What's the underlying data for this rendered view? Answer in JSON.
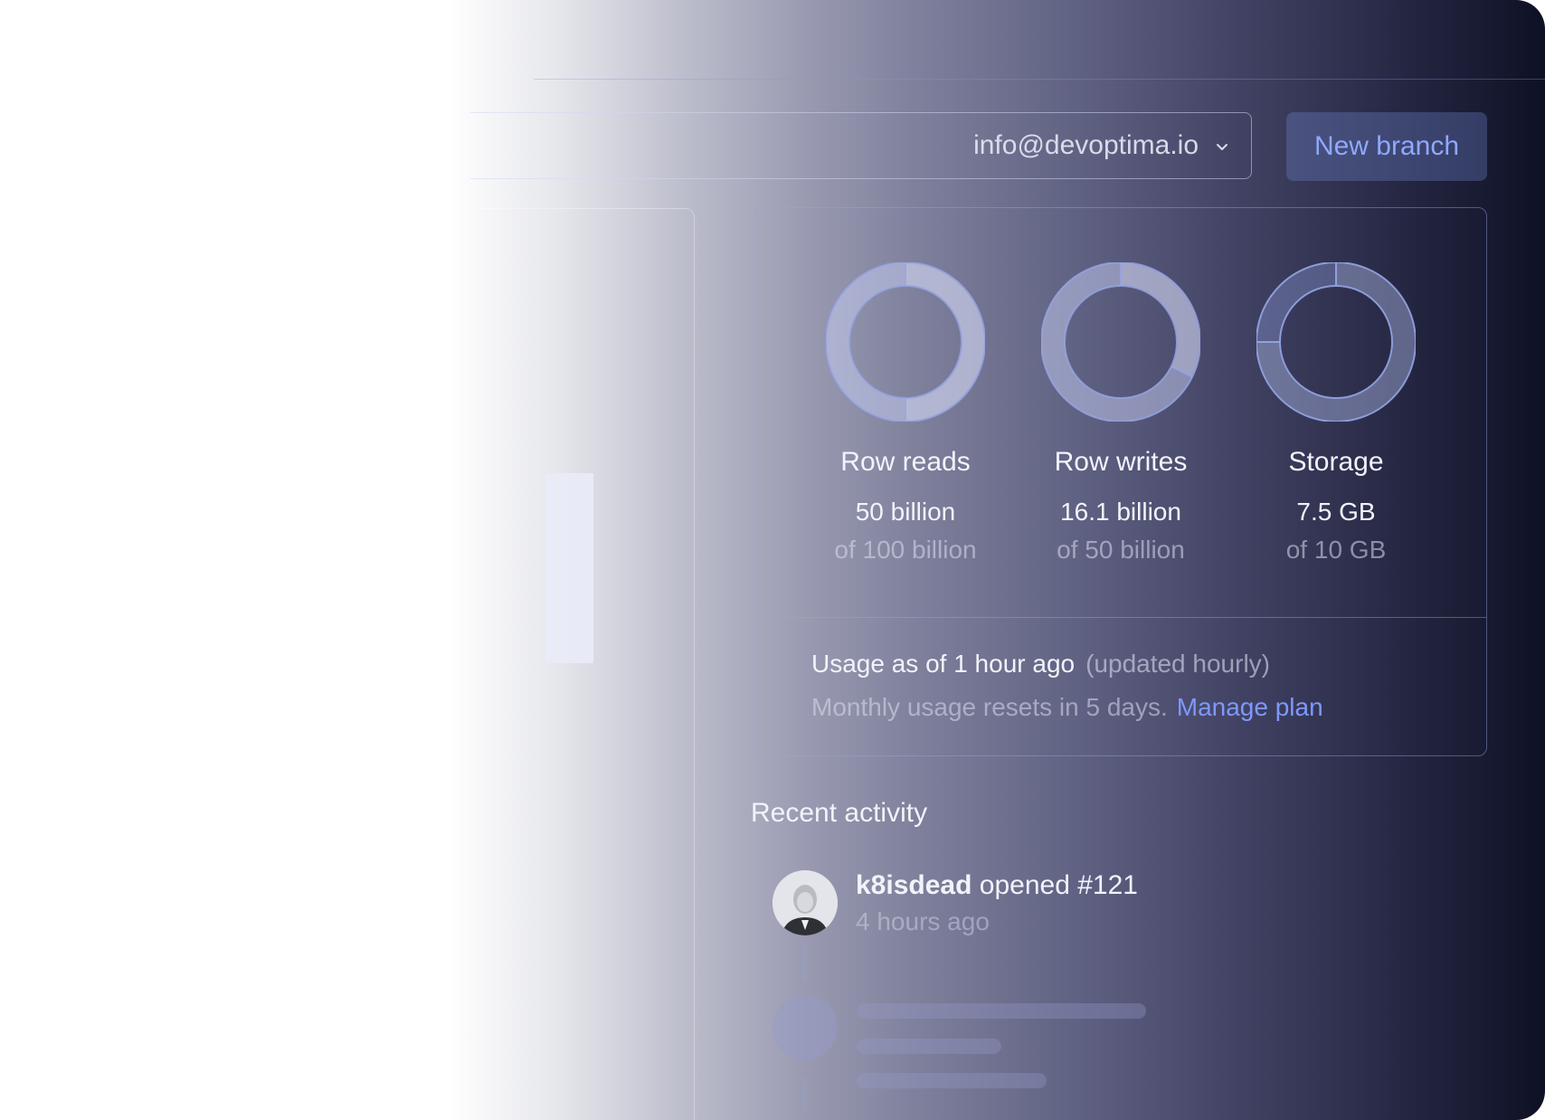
{
  "header": {
    "account_email": "info@devoptima.io",
    "new_branch_label": "New branch"
  },
  "usage": {
    "metrics": [
      {
        "title": "Row reads",
        "value": "50 billion",
        "limit": "of 100 billion",
        "fraction": 0.5
      },
      {
        "title": "Row writes",
        "value": "16.1 billion",
        "limit": "of 50 billion",
        "fraction": 0.322
      },
      {
        "title": "Storage",
        "value": "7.5 GB",
        "limit": "of 10 GB",
        "fraction": 0.75
      }
    ],
    "status": "Usage as of 1 hour ago",
    "status_note": "(updated hourly)",
    "reset_text": "Monthly usage resets in 5 days.",
    "manage_link": "Manage plan"
  },
  "activity": {
    "title": "Recent activity",
    "items": [
      {
        "user": "k8isdead",
        "action": "opened #121",
        "time": "4 hours ago"
      }
    ]
  },
  "colors": {
    "accent": "#8fa9ff",
    "link": "#7f97ff"
  },
  "icons": {
    "account_dropdown": "chevron-down-icon"
  }
}
